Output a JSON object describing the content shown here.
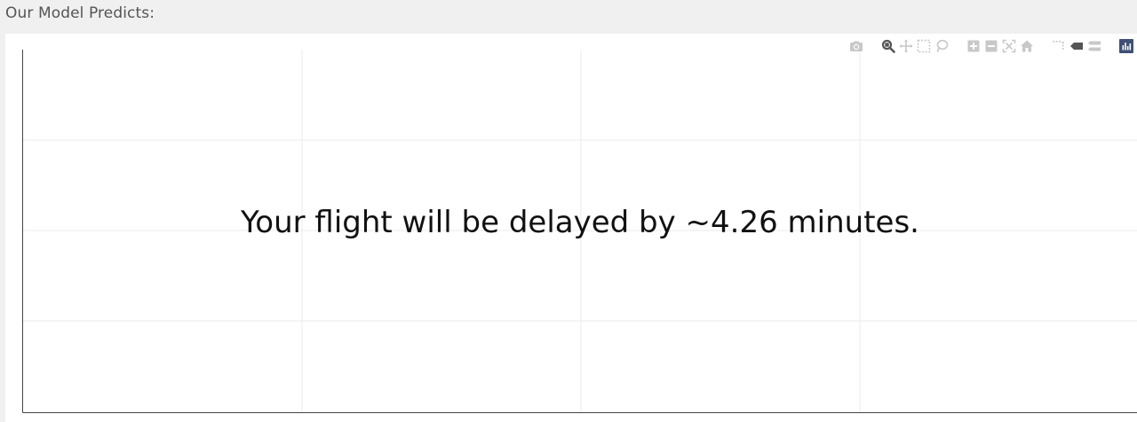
{
  "header": {
    "label": "Our Model Predicts:"
  },
  "prediction": {
    "message": "Your flight will be delayed by ~4.26 minutes."
  },
  "plot": {
    "grid": true,
    "axes_visible": false,
    "grid_color": "#ebebeb",
    "axis_color": "#444444"
  },
  "modebar": {
    "active_color": "#555555",
    "inactive_color": "#c8c8c8",
    "logo_bg": "#3f4f75",
    "groups": [
      [
        "camera-icon"
      ],
      [
        "zoom-icon",
        "pan-icon",
        "box-select-icon",
        "lasso-select-icon"
      ],
      [
        "zoom-in-icon",
        "zoom-out-icon",
        "autoscale-icon",
        "reset-axes-icon"
      ],
      [
        "spike-lines-icon",
        "hover-closest-icon",
        "hover-compare-icon"
      ],
      [
        "plotly-logo-icon"
      ]
    ]
  }
}
